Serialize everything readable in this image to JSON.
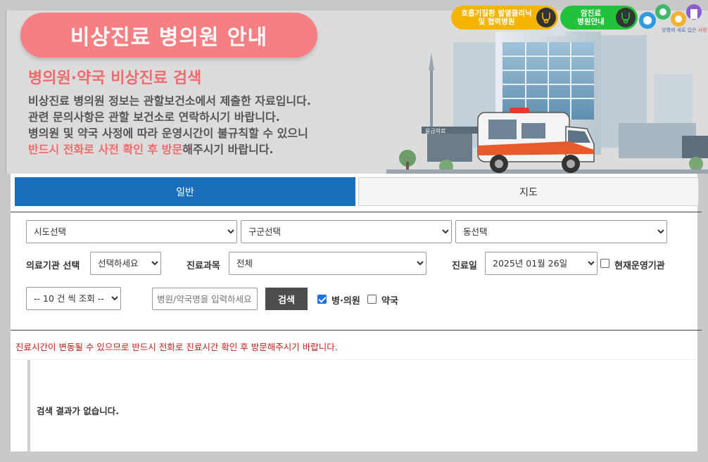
{
  "banner": {
    "title": "비상진료 병의원 안내",
    "subtitle": "병의원·약국 비상진료 검색",
    "desc_line1": "비상진료 병의원 정보는 관할보건소에서 제출한 자료입니다.",
    "desc_line2": "관련 문의사항은 관할 보건소로 연락하시기 바랍니다.",
    "desc_line3": "병의원 및 약국 사정에 따라 운영시간이 불규칙할 수 있으니",
    "desc_line4_highlight": "반드시 전화로 사전 확인 후 방문",
    "desc_line4_rest": "해주시기 바랍니다.",
    "building_sign": "응급의료"
  },
  "badges": {
    "resp_line1": "호흡기질환 발열클리닉",
    "resp_line2": "및 협력병원",
    "cancer_line1": "암진료",
    "cancer_line2": "병원안내",
    "logo_tag_blue": "양평에 새로 입은 ",
    "logo_tag_red": "사랑"
  },
  "tabs": {
    "general": "일반",
    "map": "지도"
  },
  "filters": {
    "sido": "시도선택",
    "gugun": "구군선택",
    "dong": "동선택",
    "org_label": "의료기관 선택",
    "org_select": "선택하세요",
    "dept_label": "진료과목",
    "dept_select": "전체",
    "date_label": "진료일",
    "date_select": "2025년 01월 26일",
    "open_now_label": "현재운영기관",
    "page_size": "-- 10 건 씩 조회 --",
    "search_placeholder": "병원/약국명을 입력하세요",
    "search_button": "검색",
    "hospital_label": "병·의원",
    "pharmacy_label": "약국"
  },
  "notice": "진료시간이 변동될 수 있으므로 반드시 전화로 진료시간 확인 후 방문해주시기 바랍니다.",
  "result": {
    "empty": "검색 결과가 없습니다."
  },
  "colors": {
    "primary_blue": "#1a6fbb",
    "pink": "#f57f82",
    "notice_red": "#c0201e"
  }
}
